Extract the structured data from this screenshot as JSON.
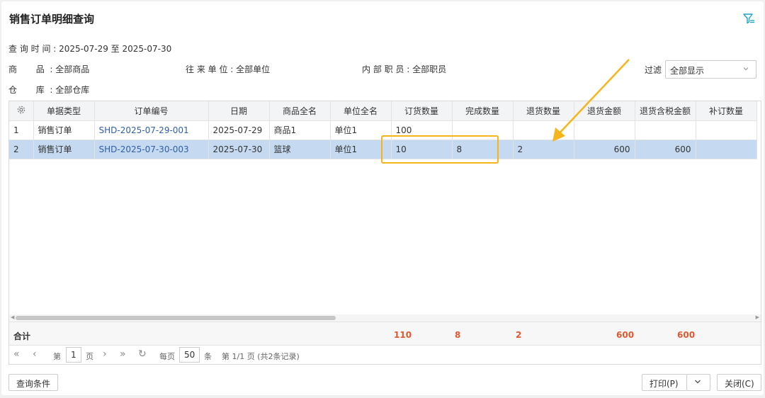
{
  "header": {
    "title": "销售订单明细查询"
  },
  "conditions": {
    "time": "查 询 时 间 : 2025-07-29 至 2025-07-30",
    "product": "商       品  : 全部商品",
    "partner": "往 来 单 位 : 全部单位",
    "staff": "内 部 职 员 : 全部职员",
    "warehouse": "仓       库  : 全部仓库"
  },
  "filter": {
    "label": "过滤",
    "value": "全部显示"
  },
  "table": {
    "columns": [
      "",
      "单据类型",
      "订单编号",
      "日期",
      "商品全名",
      "单位全名",
      "订货数量",
      "完成数量",
      "退货数量",
      "退货金额",
      "退货含税金额",
      "补订数量"
    ],
    "rows": [
      {
        "idx": "1",
        "type": "销售订单",
        "order_no": "SHD-2025-07-29-001",
        "date": "2025-07-29",
        "product": "商品1",
        "unit": "单位1",
        "order_qty": "100",
        "done_qty": "",
        "return_qty": "",
        "return_amt": "",
        "return_tax_amt": "",
        "reorder_qty": ""
      },
      {
        "idx": "2",
        "type": "销售订单",
        "order_no": "SHD-2025-07-30-003",
        "date": "2025-07-30",
        "product": "篮球",
        "unit": "单位1",
        "order_qty": "10",
        "done_qty": "8",
        "return_qty": "2",
        "return_amt": "600",
        "return_tax_amt": "600",
        "reorder_qty": ""
      }
    ],
    "totals": {
      "label": "合计",
      "order_qty": "110",
      "done_qty": "8",
      "return_qty": "2",
      "return_amt": "600",
      "return_tax_amt": "600"
    }
  },
  "pager": {
    "page_prefix": "第",
    "page": "1",
    "page_suffix": "页",
    "per_page_prefix": "每页",
    "per_page": "50",
    "per_page_suffix": "条",
    "summary": "第 1/1 页 (共2条记录)"
  },
  "footer": {
    "query_button": "查询条件",
    "print_button": "打印(P)",
    "close_button": "关闭(C)"
  },
  "colors": {
    "highlight": "#f6b51b",
    "total_red": "#e4572e",
    "selected_row": "#c5d9f1",
    "link": "#2f5fa8"
  }
}
